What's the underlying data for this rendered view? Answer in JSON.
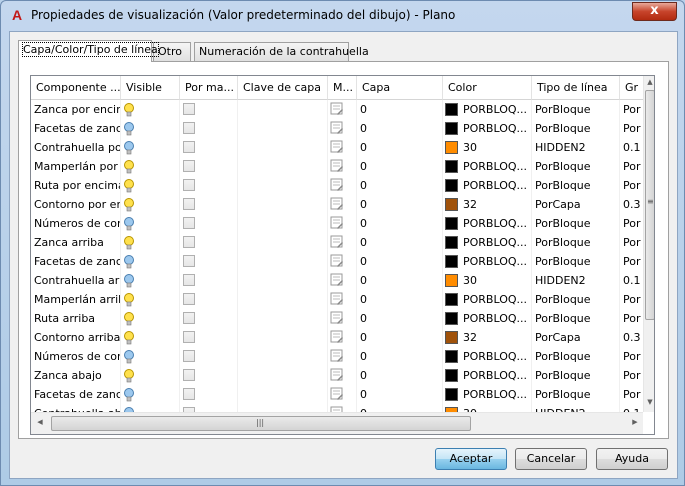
{
  "window": {
    "title": "Propiedades de visualización (Valor predeterminado del dibujo) - Plano",
    "close_label": "x",
    "app_icon_glyph": "A"
  },
  "tabs": [
    {
      "label": "Capa/Color/Tipo de línea",
      "active": true
    },
    {
      "label": "Otro",
      "active": false
    },
    {
      "label": "Numeración de la contrahuella",
      "active": false
    }
  ],
  "grid": {
    "columns": [
      "Componente ...",
      "Visible",
      "Por ma...",
      "Clave de capa",
      "M...",
      "Capa",
      "Color",
      "Tipo de línea",
      "Gr"
    ],
    "rows": [
      {
        "componente": "Zanca por encima",
        "visible": "yellow",
        "capa": "0",
        "color": "#000000",
        "color_text": "PORBLOQ...",
        "linetype": "PorBloque",
        "gr": "Por"
      },
      {
        "componente": "Facetas de zanca",
        "visible": "blue",
        "capa": "0",
        "color": "#000000",
        "color_text": "PORBLOQ...",
        "linetype": "PorBloque",
        "gr": "Por"
      },
      {
        "componente": "Contrahuella por e",
        "visible": "blue",
        "capa": "0",
        "color": "#ff8c00",
        "color_text": "30",
        "linetype": "HIDDEN2",
        "gr": "0.1"
      },
      {
        "componente": "Mamperlán por enc",
        "visible": "yellow",
        "capa": "0",
        "color": "#000000",
        "color_text": "PORBLOQ...",
        "linetype": "PorBloque",
        "gr": "Por"
      },
      {
        "componente": "Ruta por encima d",
        "visible": "yellow",
        "capa": "0",
        "color": "#000000",
        "color_text": "PORBLOQ...",
        "linetype": "PorBloque",
        "gr": "Por"
      },
      {
        "componente": "Contorno por enci",
        "visible": "yellow",
        "capa": "0",
        "color": "#a0520a",
        "color_text": "32",
        "linetype": "PorCapa",
        "gr": "0.3"
      },
      {
        "componente": "Números de contr",
        "visible": "blue",
        "capa": "0",
        "color": "#000000",
        "color_text": "PORBLOQ...",
        "linetype": "PorBloque",
        "gr": "Por"
      },
      {
        "componente": "Zanca arriba",
        "visible": "yellow",
        "capa": "0",
        "color": "#000000",
        "color_text": "PORBLOQ...",
        "linetype": "PorBloque",
        "gr": "Por"
      },
      {
        "componente": "Facetas de zanca",
        "visible": "blue",
        "capa": "0",
        "color": "#000000",
        "color_text": "PORBLOQ...",
        "linetype": "PorBloque",
        "gr": "Por"
      },
      {
        "componente": "Contrahuella arriba",
        "visible": "blue",
        "capa": "0",
        "color": "#ff8c00",
        "color_text": "30",
        "linetype": "HIDDEN2",
        "gr": "0.1"
      },
      {
        "componente": "Mamperlán arriba",
        "visible": "yellow",
        "capa": "0",
        "color": "#000000",
        "color_text": "PORBLOQ...",
        "linetype": "PorBloque",
        "gr": "Por"
      },
      {
        "componente": "Ruta arriba",
        "visible": "yellow",
        "capa": "0",
        "color": "#000000",
        "color_text": "PORBLOQ...",
        "linetype": "PorBloque",
        "gr": "Por"
      },
      {
        "componente": "Contorno arriba",
        "visible": "yellow",
        "capa": "0",
        "color": "#a0520a",
        "color_text": "32",
        "linetype": "PorCapa",
        "gr": "0.3"
      },
      {
        "componente": "Números de contr",
        "visible": "blue",
        "capa": "0",
        "color": "#000000",
        "color_text": "PORBLOQ...",
        "linetype": "PorBloque",
        "gr": "Por"
      },
      {
        "componente": "Zanca abajo",
        "visible": "yellow",
        "capa": "0",
        "color": "#000000",
        "color_text": "PORBLOQ...",
        "linetype": "PorBloque",
        "gr": "Por"
      },
      {
        "componente": "Facetas de zanca",
        "visible": "blue",
        "capa": "0",
        "color": "#000000",
        "color_text": "PORBLOQ...",
        "linetype": "PorBloque",
        "gr": "Por"
      },
      {
        "componente": "Contrahuella abaj",
        "visible": "blue",
        "capa": "0",
        "color": "#ff8c00",
        "color_text": "30",
        "linetype": "HIDDEN2",
        "gr": "0.1"
      }
    ]
  },
  "buttons": {
    "accept": "Aceptar",
    "cancel": "Cancelar",
    "help": "Ayuda"
  }
}
